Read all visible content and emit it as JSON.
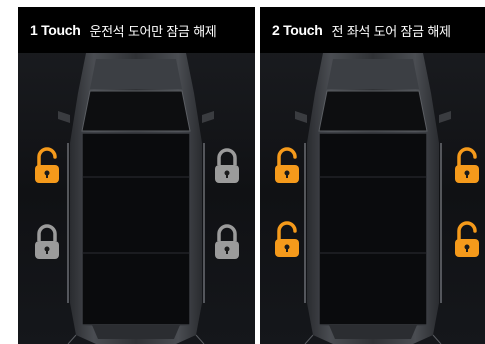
{
  "panels": [
    {
      "step": "1 Touch",
      "description": "운전석 도어만 잠금 해제",
      "locks": [
        {
          "position": "front-left",
          "state": "unlocked",
          "color": "#f59a1b"
        },
        {
          "position": "front-right",
          "state": "locked",
          "color": "#9b9b9b"
        },
        {
          "position": "rear-left",
          "state": "locked",
          "color": "#9b9b9b"
        },
        {
          "position": "rear-right",
          "state": "locked",
          "color": "#9b9b9b"
        }
      ]
    },
    {
      "step": "2 Touch",
      "description": "전 좌석 도어 잠금 해제",
      "locks": [
        {
          "position": "front-left",
          "state": "unlocked",
          "color": "#f59a1b"
        },
        {
          "position": "front-right",
          "state": "unlocked",
          "color": "#f59a1b"
        },
        {
          "position": "rear-left",
          "state": "unlocked",
          "color": "#f59a1b"
        },
        {
          "position": "rear-right",
          "state": "unlocked",
          "color": "#f59a1b"
        }
      ]
    }
  ],
  "colors": {
    "unlocked": "#f59a1b",
    "locked": "#9b9b9b",
    "header_bg": "#000000",
    "panel_bg": "#15171b"
  }
}
